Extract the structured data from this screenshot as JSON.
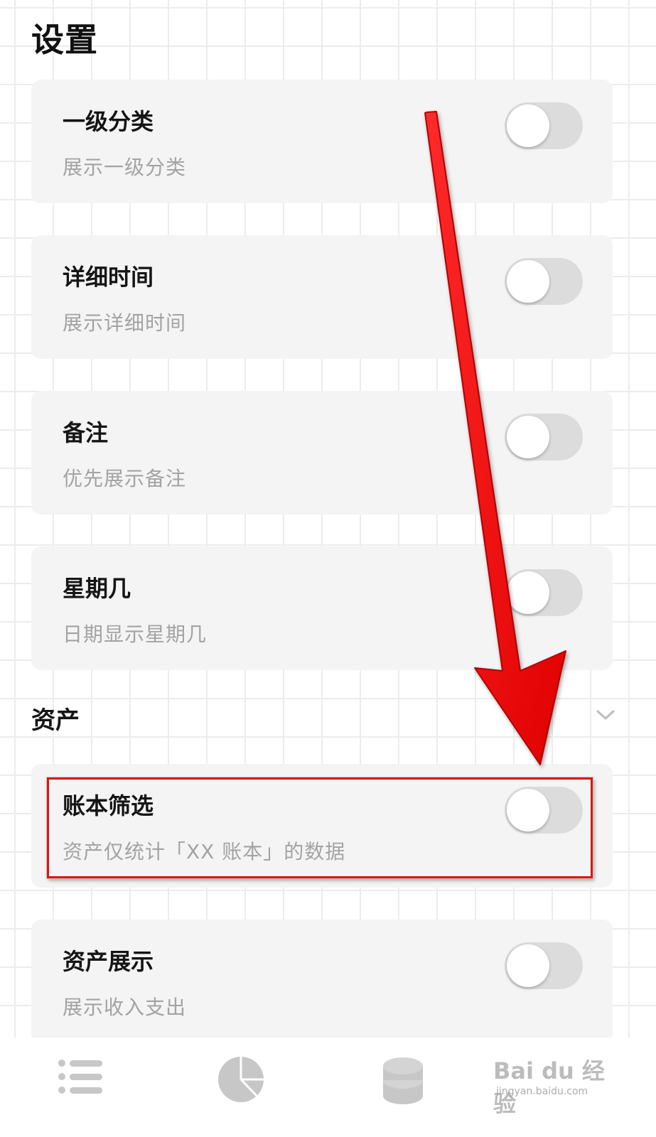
{
  "page": {
    "title": "设置"
  },
  "settings": [
    {
      "title": "一级分类",
      "description": "展示一级分类",
      "enabled": false
    },
    {
      "title": "详细时间",
      "description": "展示详细时间",
      "enabled": false
    },
    {
      "title": "备注",
      "description": "优先展示备注",
      "enabled": false
    },
    {
      "title": "星期几",
      "description": "日期显示星期几",
      "enabled": false
    }
  ],
  "asset_section": {
    "title": "资产",
    "icon": "chevron-down-icon",
    "items": [
      {
        "title": "账本筛选",
        "description": "资产仅统计「XX 账本」的数据",
        "enabled": false
      },
      {
        "title": "资产展示",
        "description": "展示收入支出",
        "enabled": false
      }
    ]
  },
  "annotation": {
    "color": "#e31212"
  },
  "tabbar": {
    "tabs": [
      {
        "icon": "list-icon"
      },
      {
        "icon": "pie-chart-icon"
      },
      {
        "icon": "coins-stack-icon"
      }
    ]
  },
  "watermark": {
    "logo": "Bai du 经验",
    "url": "jingyan.baidu.com"
  }
}
